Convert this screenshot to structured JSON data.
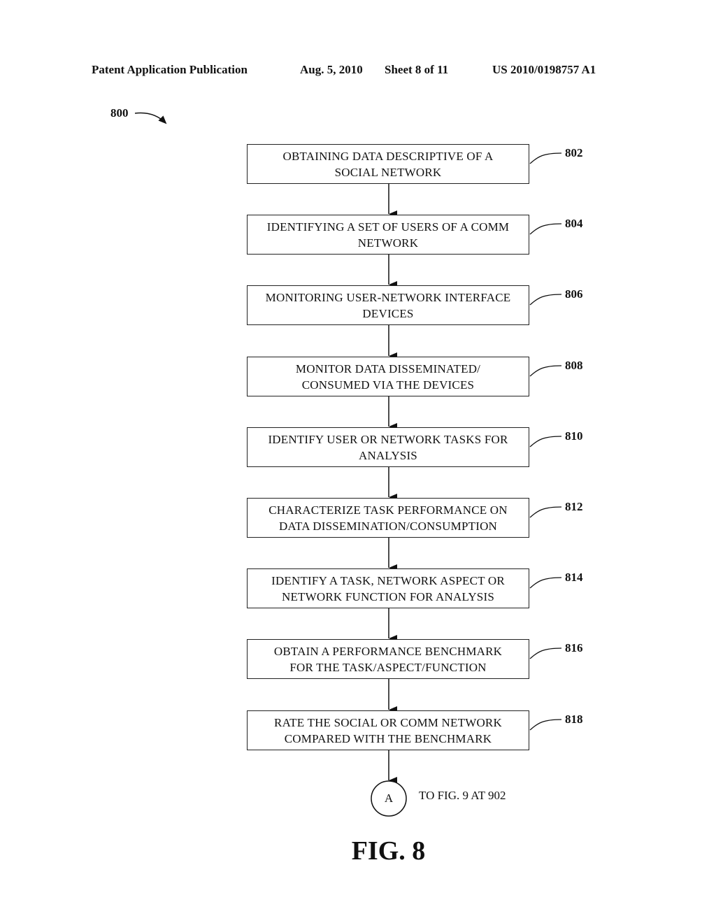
{
  "header": {
    "publication": "Patent Application Publication",
    "date": "Aug. 5, 2010",
    "sheet": "Sheet 8 of 11",
    "pub_number": "US 2010/0198757 A1"
  },
  "figure": {
    "number_label": "800",
    "caption": "FIG. 8",
    "steps": [
      {
        "ref": "802",
        "lines": [
          "OBTAINING DATA DESCRIPTIVE OF A",
          "SOCIAL NETWORK"
        ]
      },
      {
        "ref": "804",
        "lines": [
          "IDENTIFYING A SET OF USERS OF A COMM",
          "NETWORK"
        ]
      },
      {
        "ref": "806",
        "lines": [
          "MONITORING USER-NETWORK INTERFACE",
          "DEVICES"
        ]
      },
      {
        "ref": "808",
        "lines": [
          "MONITOR DATA DISSEMINATED/",
          "CONSUMED VIA THE DEVICES"
        ]
      },
      {
        "ref": "810",
        "lines": [
          "IDENTIFY USER OR NETWORK TASKS FOR",
          "ANALYSIS"
        ]
      },
      {
        "ref": "812",
        "lines": [
          "CHARACTERIZE TASK PERFORMANCE ON",
          "DATA DISSEMINATION/CONSUMPTION"
        ]
      },
      {
        "ref": "814",
        "lines": [
          "IDENTIFY A TASK, NETWORK ASPECT OR",
          "NETWORK FUNCTION FOR ANALYSIS"
        ]
      },
      {
        "ref": "816",
        "lines": [
          "OBTAIN A PERFORMANCE BENCHMARK",
          "FOR THE TASK/ASPECT/FUNCTION"
        ]
      },
      {
        "ref": "818",
        "lines": [
          "RATE THE SOCIAL OR COMM NETWORK",
          "COMPARED WITH THE BENCHMARK"
        ]
      }
    ],
    "connector": {
      "letter": "A",
      "text": "TO FIG. 9 AT 902"
    }
  }
}
